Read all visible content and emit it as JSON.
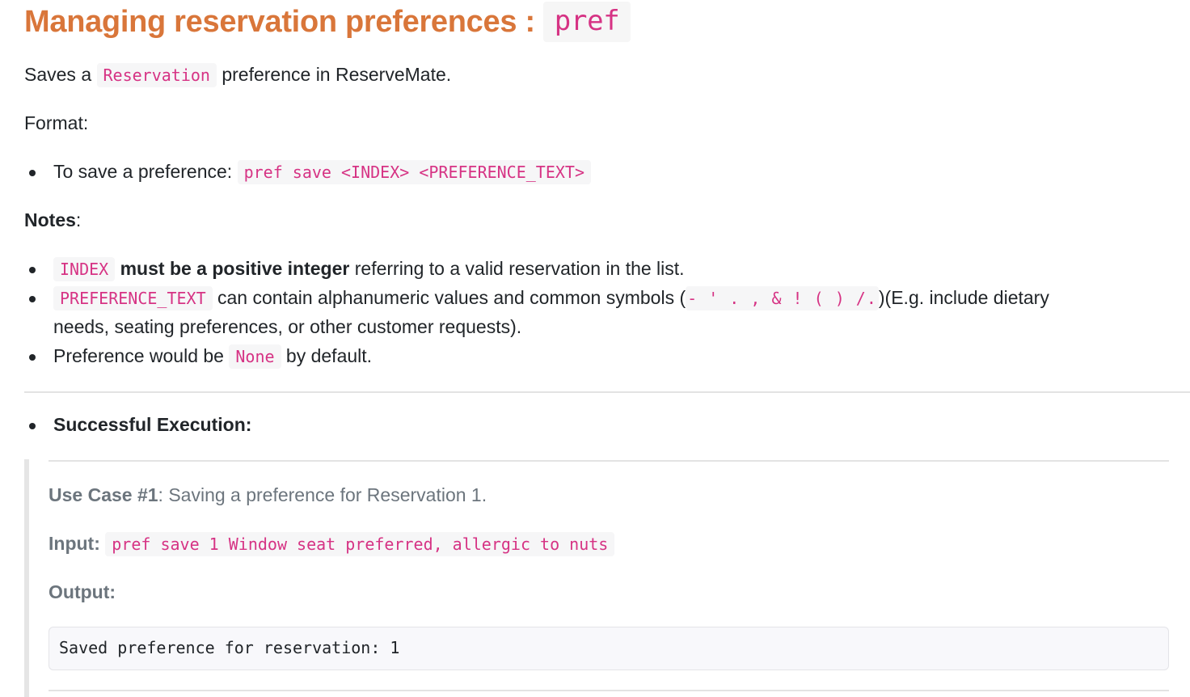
{
  "header": {
    "title": "Managing reservation preferences :",
    "title_code": "pref"
  },
  "intro": {
    "before": "Saves a",
    "code": "Reservation",
    "after": "preference in ReserveMate."
  },
  "format": {
    "label": "Format:",
    "items": [
      {
        "text": "To save a preference:",
        "code": "pref save <INDEX> <PREFERENCE_TEXT>"
      }
    ]
  },
  "notes": {
    "label": "Notes",
    "colon": ":",
    "items": [
      {
        "code": "INDEX",
        "bold": "must be a positive integer",
        "after": "referring to a valid reservation in the list."
      },
      {
        "code": "PREFERENCE_TEXT",
        "before_symbols": "can contain alphanumeric values and common symbols (",
        "symbols": "- ' . , & ! ( ) /.",
        "after_symbols": ")(E.g. include dietary",
        "line2": "needs, seating preferences, or other customer requests)."
      },
      {
        "before": "Preference would be",
        "code": "None",
        "after": "by default."
      }
    ]
  },
  "execution": {
    "heading": "Successful Execution:",
    "use_case_label": "Use Case #1",
    "use_case_text": ": Saving a preference for Reservation 1.",
    "input_label": "Input:",
    "input_code": "pref save 1 Window seat preferred, allergic to nuts",
    "output_label": "Output:",
    "output_text": "Saved preference for reservation: 1"
  }
}
